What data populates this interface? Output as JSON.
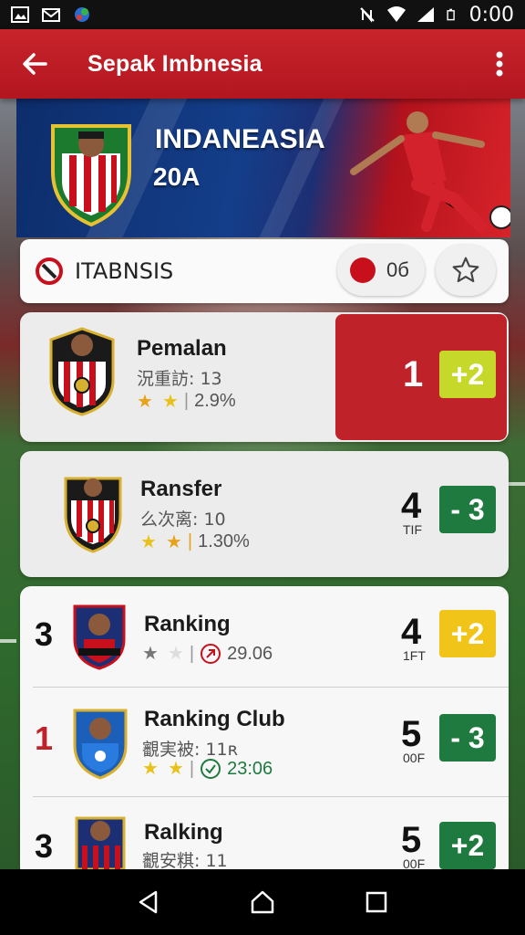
{
  "status_bar": {
    "time": "0:00",
    "left_icons": [
      "image-icon",
      "email-icon",
      "app-icon"
    ],
    "right_icons": [
      "no-nfc-icon",
      "wifi-icon",
      "battery-icon"
    ]
  },
  "app_bar": {
    "title": "Sepak Imbnesia",
    "back_icon": "arrow-back-icon",
    "menu_icon": "more-vert-icon"
  },
  "hero": {
    "title": "INDANEASIA",
    "subtitle": "20A"
  },
  "filter_bar": {
    "label": "ITABNSIS",
    "pill_value": "0б",
    "star_icon": "star-outline-icon"
  },
  "rows": [
    {
      "name": "Pemalan",
      "sub": "況重訪: 13",
      "stars": 2,
      "meta": "2.9%",
      "big": "1",
      "small": "",
      "badge": "+2",
      "badge_color": "#c6d82a",
      "highlight": true
    },
    {
      "name": "Ransfer",
      "sub": "么次离: 10",
      "stars": 2,
      "meta": "1.30%",
      "big": "4",
      "small": "TIF",
      "badge": "- 3",
      "badge_color": "#1e7a3e"
    },
    {
      "rank": "3",
      "name": "Ranking",
      "stars": 1,
      "meta": "29.06",
      "big": "4",
      "small": "1FT",
      "badge": "+2",
      "badge_color": "#f0c419"
    },
    {
      "rank": "1",
      "rank_color": "#c0222a",
      "name": "Ranking Club",
      "sub": "覾実被: 11ʀ",
      "stars": 2,
      "meta": "23:06",
      "big": "5",
      "small": "00F",
      "badge": "- 3",
      "badge_color": "#1e7a3e"
    },
    {
      "rank": "3",
      "name": "Ralking",
      "sub": "覾安粸: 11",
      "big": "5",
      "small": "00F",
      "badge": "+2",
      "badge_color": "#1e7a3e"
    }
  ],
  "colors": {
    "primary": "#c8242c",
    "green": "#1e7a3e",
    "yellow": "#f0c419",
    "lime": "#c6d82a"
  },
  "nav": {
    "back": "nav-back-icon",
    "home": "nav-home-icon",
    "recents": "nav-recents-icon"
  }
}
